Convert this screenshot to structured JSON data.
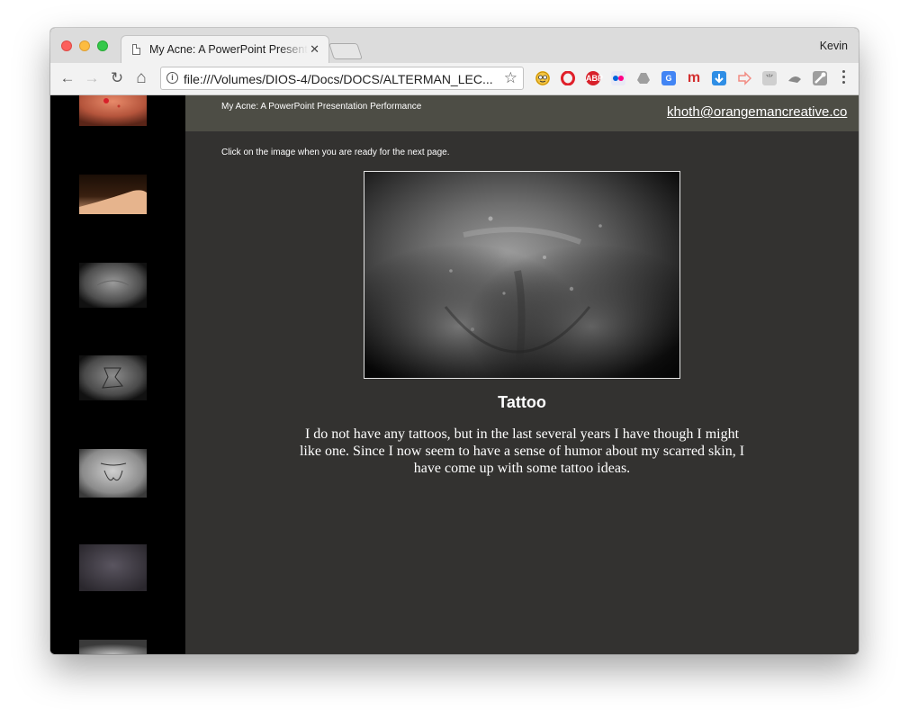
{
  "browser": {
    "tab_title": "My Acne: A PowerPoint Presentation Performance",
    "tab_close": "✕",
    "profile_name": "Kevin",
    "url": "file:///Volumes/DIOS-4/Docs/DOCS/ALTERMAN_LEC...",
    "back": "←",
    "forward": "→",
    "reload": "↻",
    "home": "⌂",
    "star": "☆",
    "extensions": [
      "emoji-icon",
      "opera-icon",
      "adblock-icon",
      "flickr-icon",
      "drive-icon",
      "translate-icon",
      "m-icon",
      "download-icon",
      "arrow-icon",
      "tool-icon",
      "eye-icon",
      "wrench-icon"
    ],
    "adblock_label": "ABP",
    "m_label": "m"
  },
  "page": {
    "site_title": "My Acne: A PowerPoint Presentation Performance",
    "email": "khoth@orangemancreative.co",
    "instruction": "Click on the image when you are ready for the next page.",
    "slide_title": "Tattoo",
    "slide_text": "I do not have any tattoos, but in the last several years I have though I might like one. Since I now seem to have a sense of humor about my scarred skin, I have come up with some tattoo ideas.",
    "thumbnails": [
      "red-skin-thumb",
      "arm-thumb",
      "chest-gray-thumb",
      "chest-tattoo-thumb",
      "chest-tattoo-light-thumb",
      "skin-dark-thumb",
      "chest-partial-thumb"
    ]
  },
  "colors": {
    "header_band": "#4d4d45",
    "content_bg": "#333230",
    "filmstrip_bg": "#000000"
  }
}
